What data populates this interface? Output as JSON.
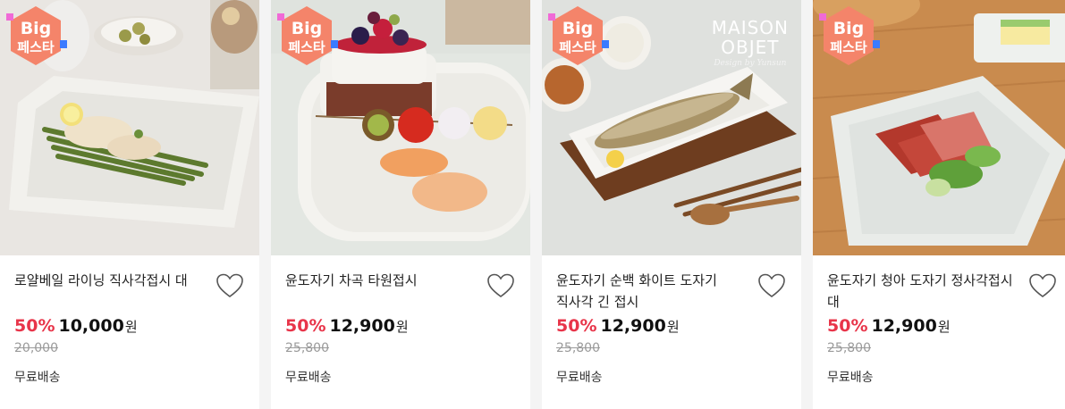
{
  "products": [
    {
      "badge": {
        "line1": "Big",
        "line2": "페스타"
      },
      "title": "로얄베일 라이닝 직사각접시 대",
      "discount": "50%",
      "price": "10,000",
      "currency": "원",
      "original_price": "20,000",
      "shipping": "무료배송"
    },
    {
      "badge": {
        "line1": "Big",
        "line2": "페스타"
      },
      "title": "윤도자기 차곡 타원접시",
      "discount": "50%",
      "price": "12,900",
      "currency": "원",
      "original_price": "25,800",
      "shipping": "무료배송"
    },
    {
      "badge": {
        "line1": "Big",
        "line2": "페스타"
      },
      "brand": {
        "line1": "MAISON",
        "line2": "OBJET",
        "line3": "Design by Yunsun"
      },
      "title": "윤도자기 순백 화이트 도자기 직사각 긴 접시",
      "discount": "50%",
      "price": "12,900",
      "currency": "원",
      "original_price": "25,800",
      "shipping": "무료배송"
    },
    {
      "badge": {
        "line1": "Big",
        "line2": "페스타"
      },
      "title": "윤도자기 청아 도자기 정사각접시 대",
      "discount": "50%",
      "price": "12,900",
      "currency": "원",
      "original_price": "25,800",
      "shipping": "무료배송"
    }
  ],
  "colors": {
    "discount": "#e8354a",
    "badge_fill": "#f4846a",
    "badge_accent_blue": "#3b7bff",
    "badge_accent_pink": "#f06ad6"
  },
  "icons": {
    "wishlist": "heart-outline-icon",
    "badge": "big-festa-badge"
  }
}
